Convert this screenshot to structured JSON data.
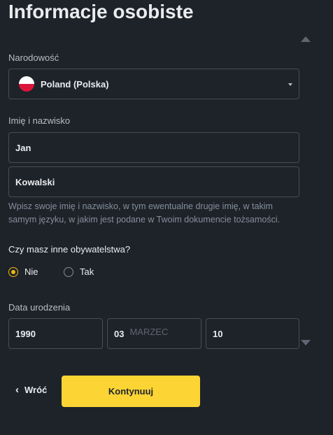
{
  "page": {
    "title": "Informacje osobiste"
  },
  "nationality": {
    "label": "Narodowość",
    "value": "Poland (Polska)",
    "flag_colors": [
      "#ffffff",
      "#dc143c"
    ]
  },
  "name": {
    "label": "Imię i nazwisko",
    "first_name": "Jan",
    "last_name": "Kowalski",
    "hint": "Wpisz swoje imię i nazwisko, w tym ewentualne drugie imię, w takim samym języku, w jakim jest podane w Twoim dokumencie tożsamości."
  },
  "citizenship": {
    "question": "Czy masz inne obywatelstwa?",
    "options": [
      {
        "label": "Nie",
        "selected": true
      },
      {
        "label": "Tak",
        "selected": false
      }
    ]
  },
  "birth_date": {
    "label": "Data urodzenia",
    "year": "1990",
    "month_number": "03",
    "month_name": "MARZEC",
    "day": "10"
  },
  "actions": {
    "back_label": "Wróć",
    "continue_label": "Kontynuuj"
  },
  "colors": {
    "background": "#1e2329",
    "accent": "#fcd535",
    "radio_checked": "#f0b90b",
    "border": "#474d57"
  }
}
